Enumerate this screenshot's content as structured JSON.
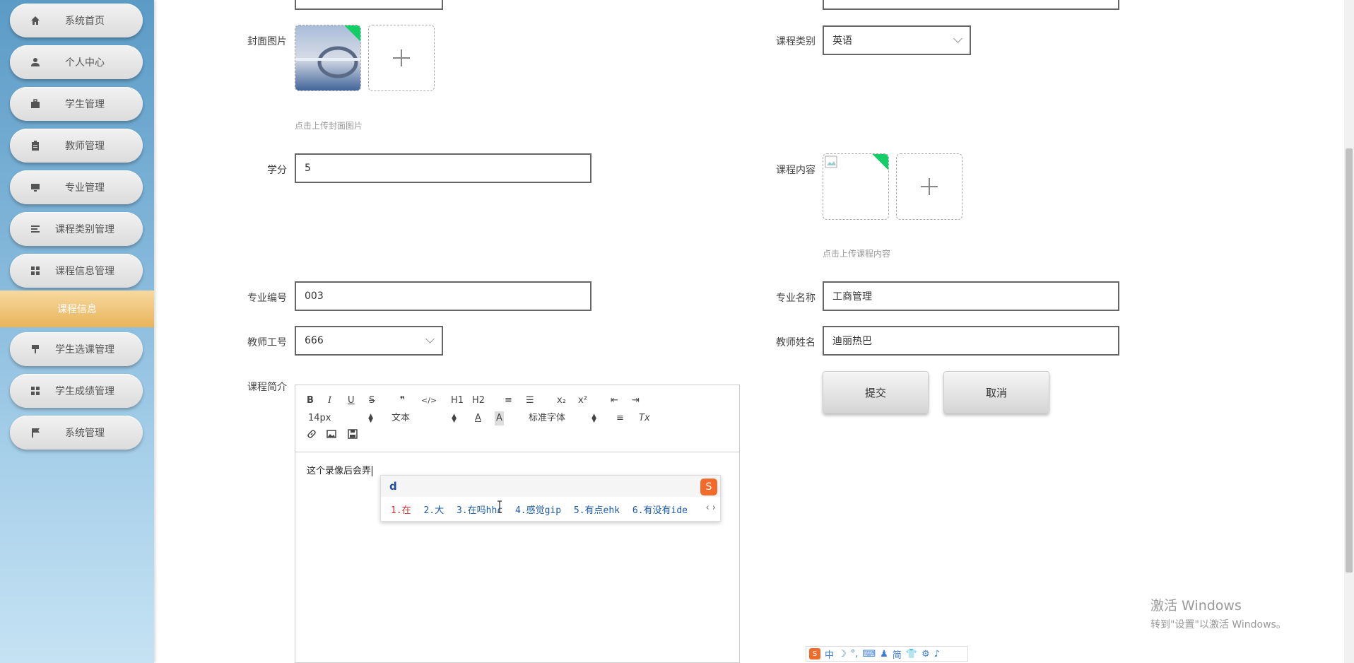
{
  "sidebar": {
    "items": [
      {
        "label": "系统首页",
        "icon": "home-icon"
      },
      {
        "label": "个人中心",
        "icon": "user-icon"
      },
      {
        "label": "学生管理",
        "icon": "briefcase-icon"
      },
      {
        "label": "教师管理",
        "icon": "clipboard-icon"
      },
      {
        "label": "专业管理",
        "icon": "monitor-icon"
      },
      {
        "label": "课程类别管理",
        "icon": "list-icon"
      },
      {
        "label": "课程信息管理",
        "icon": "grid-icon"
      },
      {
        "label": "学生选课管理",
        "icon": "pin-icon"
      },
      {
        "label": "学生成绩管理",
        "icon": "grid-icon"
      },
      {
        "label": "系统管理",
        "icon": "flag-icon"
      }
    ],
    "active_sub": "课程信息"
  },
  "form": {
    "cover_label": "封面图片",
    "cover_hint": "点击上传封面图片",
    "category_label": "课程类别",
    "category_value": "英语",
    "credit_label": "学分",
    "credit_value": "5",
    "content_label": "课程内容",
    "content_hint": "点击上传课程内容",
    "major_no_label": "专业编号",
    "major_no_value": "003",
    "major_name_label": "专业名称",
    "major_name_value": "工商管理",
    "teacher_no_label": "教师工号",
    "teacher_no_value": "666",
    "teacher_name_label": "教师姓名",
    "teacher_name_value": "迪丽热巴",
    "intro_label": "课程简介",
    "submit_label": "提交",
    "cancel_label": "取消"
  },
  "editor": {
    "toolbar": {
      "bold": "B",
      "italic": "I",
      "underline": "U",
      "strike": "S",
      "quote": "❞",
      "code": "</>",
      "h1": "H1",
      "h2": "H2",
      "ordered_list": "≡",
      "bullet_list": "☰",
      "subscript": "x₂",
      "superscript": "x²",
      "indent_out": "⇤",
      "indent_in": "⇥",
      "font_size": "14px",
      "text_type": "文本",
      "font_family": "标准字体",
      "align": "≡",
      "clear_format": "Tx"
    },
    "content": "这个录像后会弄"
  },
  "ime": {
    "input": "d",
    "candidates": [
      "1.在",
      "2.大",
      "3.在吗hhc",
      "4.感觉gip",
      "5.有点ehk",
      "6.有没有ide"
    ],
    "nav": "‹ ›"
  },
  "watermark": {
    "line1": "激活 Windows",
    "line2": "转到\"设置\"以激活 Windows。"
  },
  "ime_bar": [
    "中",
    "☽",
    "°,",
    "⌨",
    "♟",
    "简",
    "👕",
    "⚙",
    "♪"
  ]
}
